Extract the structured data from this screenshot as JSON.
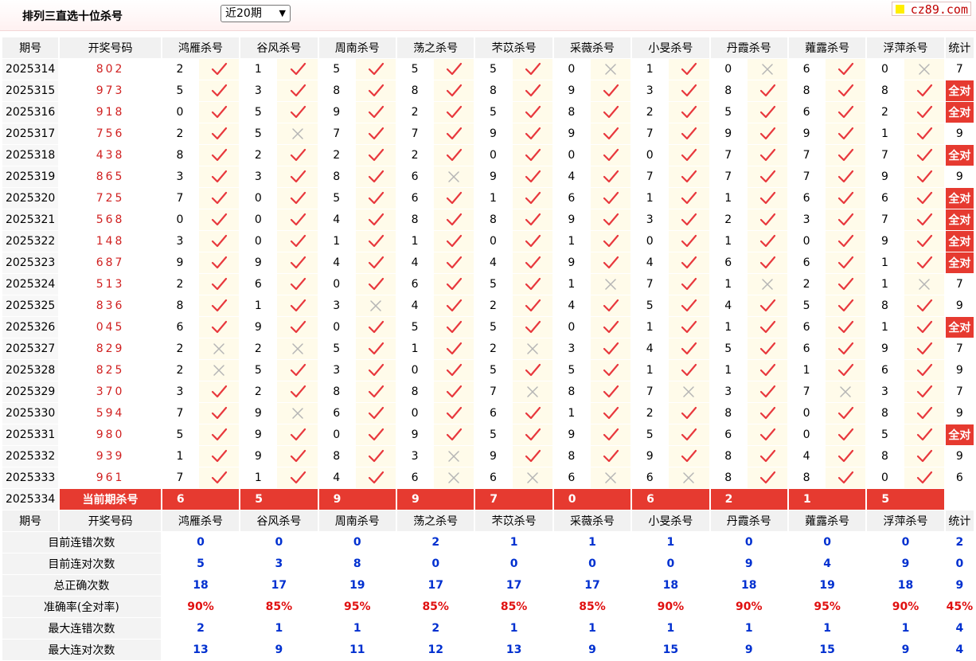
{
  "header": {
    "title": "排列三直选十位杀号",
    "period_select": "近20期",
    "logo": "cz89.com"
  },
  "columns": {
    "period": "期号",
    "draw": "开奖号码",
    "stat": "统计",
    "experts": [
      "鸿雁杀号",
      "谷风杀号",
      "周南杀号",
      "荡之杀号",
      "芣苡杀号",
      "采薇杀号",
      "小旻杀号",
      "丹霞杀号",
      "蕹露杀号",
      "浮萍杀号"
    ]
  },
  "rows": [
    {
      "period": "2025314",
      "draw": "802",
      "kills": [
        "2",
        "1",
        "5",
        "5",
        "5",
        "0",
        "1",
        "0",
        "6",
        "0"
      ],
      "hits": [
        1,
        1,
        1,
        1,
        1,
        0,
        1,
        0,
        1,
        0
      ],
      "stat": "7"
    },
    {
      "period": "2025315",
      "draw": "973",
      "kills": [
        "5",
        "3",
        "8",
        "8",
        "8",
        "9",
        "3",
        "8",
        "8",
        "8"
      ],
      "hits": [
        1,
        1,
        1,
        1,
        1,
        1,
        1,
        1,
        1,
        1
      ],
      "stat": "全对"
    },
    {
      "period": "2025316",
      "draw": "918",
      "kills": [
        "0",
        "5",
        "9",
        "2",
        "5",
        "8",
        "2",
        "5",
        "6",
        "2"
      ],
      "hits": [
        1,
        1,
        1,
        1,
        1,
        1,
        1,
        1,
        1,
        1
      ],
      "stat": "全对"
    },
    {
      "period": "2025317",
      "draw": "756",
      "kills": [
        "2",
        "5",
        "7",
        "7",
        "9",
        "9",
        "7",
        "9",
        "9",
        "1"
      ],
      "hits": [
        1,
        0,
        1,
        1,
        1,
        1,
        1,
        1,
        1,
        1
      ],
      "stat": "9"
    },
    {
      "period": "2025318",
      "draw": "438",
      "kills": [
        "8",
        "2",
        "2",
        "2",
        "0",
        "0",
        "0",
        "7",
        "7",
        "7"
      ],
      "hits": [
        1,
        1,
        1,
        1,
        1,
        1,
        1,
        1,
        1,
        1
      ],
      "stat": "全对"
    },
    {
      "period": "2025319",
      "draw": "865",
      "kills": [
        "3",
        "3",
        "8",
        "6",
        "9",
        "4",
        "7",
        "7",
        "7",
        "9"
      ],
      "hits": [
        1,
        1,
        1,
        0,
        1,
        1,
        1,
        1,
        1,
        1
      ],
      "stat": "9"
    },
    {
      "period": "2025320",
      "draw": "725",
      "kills": [
        "7",
        "0",
        "5",
        "6",
        "1",
        "6",
        "1",
        "1",
        "6",
        "6"
      ],
      "hits": [
        1,
        1,
        1,
        1,
        1,
        1,
        1,
        1,
        1,
        1
      ],
      "stat": "全对"
    },
    {
      "period": "2025321",
      "draw": "568",
      "kills": [
        "0",
        "0",
        "4",
        "8",
        "8",
        "9",
        "3",
        "2",
        "3",
        "7"
      ],
      "hits": [
        1,
        1,
        1,
        1,
        1,
        1,
        1,
        1,
        1,
        1
      ],
      "stat": "全对"
    },
    {
      "period": "2025322",
      "draw": "148",
      "kills": [
        "3",
        "0",
        "1",
        "1",
        "0",
        "1",
        "0",
        "1",
        "0",
        "9"
      ],
      "hits": [
        1,
        1,
        1,
        1,
        1,
        1,
        1,
        1,
        1,
        1
      ],
      "stat": "全对"
    },
    {
      "period": "2025323",
      "draw": "687",
      "kills": [
        "9",
        "9",
        "4",
        "4",
        "4",
        "9",
        "4",
        "6",
        "6",
        "1"
      ],
      "hits": [
        1,
        1,
        1,
        1,
        1,
        1,
        1,
        1,
        1,
        1
      ],
      "stat": "全对"
    },
    {
      "period": "2025324",
      "draw": "513",
      "kills": [
        "2",
        "6",
        "0",
        "6",
        "5",
        "1",
        "7",
        "1",
        "2",
        "1"
      ],
      "hits": [
        1,
        1,
        1,
        1,
        1,
        0,
        1,
        0,
        1,
        0
      ],
      "stat": "7"
    },
    {
      "period": "2025325",
      "draw": "836",
      "kills": [
        "8",
        "1",
        "3",
        "4",
        "2",
        "4",
        "5",
        "4",
        "5",
        "8"
      ],
      "hits": [
        1,
        1,
        0,
        1,
        1,
        1,
        1,
        1,
        1,
        1
      ],
      "stat": "9"
    },
    {
      "period": "2025326",
      "draw": "045",
      "kills": [
        "6",
        "9",
        "0",
        "5",
        "5",
        "0",
        "1",
        "1",
        "6",
        "1"
      ],
      "hits": [
        1,
        1,
        1,
        1,
        1,
        1,
        1,
        1,
        1,
        1
      ],
      "stat": "全对"
    },
    {
      "period": "2025327",
      "draw": "829",
      "kills": [
        "2",
        "2",
        "5",
        "1",
        "2",
        "3",
        "4",
        "5",
        "6",
        "9"
      ],
      "hits": [
        0,
        0,
        1,
        1,
        0,
        1,
        1,
        1,
        1,
        1
      ],
      "stat": "7"
    },
    {
      "period": "2025328",
      "draw": "825",
      "kills": [
        "2",
        "5",
        "3",
        "0",
        "5",
        "5",
        "1",
        "1",
        "1",
        "6"
      ],
      "hits": [
        0,
        1,
        1,
        1,
        1,
        1,
        1,
        1,
        1,
        1
      ],
      "stat": "9"
    },
    {
      "period": "2025329",
      "draw": "370",
      "kills": [
        "3",
        "2",
        "8",
        "8",
        "7",
        "8",
        "7",
        "3",
        "7",
        "3"
      ],
      "hits": [
        1,
        1,
        1,
        1,
        0,
        1,
        0,
        1,
        0,
        1
      ],
      "stat": "7"
    },
    {
      "period": "2025330",
      "draw": "594",
      "kills": [
        "7",
        "9",
        "6",
        "0",
        "6",
        "1",
        "2",
        "8",
        "0",
        "8"
      ],
      "hits": [
        1,
        0,
        1,
        1,
        1,
        1,
        1,
        1,
        1,
        1
      ],
      "stat": "9"
    },
    {
      "period": "2025331",
      "draw": "980",
      "kills": [
        "5",
        "9",
        "0",
        "9",
        "5",
        "9",
        "5",
        "6",
        "0",
        "5"
      ],
      "hits": [
        1,
        1,
        1,
        1,
        1,
        1,
        1,
        1,
        1,
        1
      ],
      "stat": "全对"
    },
    {
      "period": "2025332",
      "draw": "939",
      "kills": [
        "1",
        "9",
        "8",
        "3",
        "9",
        "8",
        "9",
        "8",
        "4",
        "8"
      ],
      "hits": [
        1,
        1,
        1,
        0,
        1,
        1,
        1,
        1,
        1,
        1
      ],
      "stat": "9"
    },
    {
      "period": "2025333",
      "draw": "961",
      "kills": [
        "7",
        "1",
        "4",
        "6",
        "6",
        "6",
        "6",
        "8",
        "8",
        "0"
      ],
      "hits": [
        1,
        1,
        1,
        0,
        0,
        0,
        0,
        1,
        1,
        1
      ],
      "stat": "6"
    }
  ],
  "current": {
    "period": "2025334",
    "label": "当前期杀号",
    "kills": [
      "6",
      "5",
      "9",
      "9",
      "7",
      "0",
      "6",
      "2",
      "1",
      "5"
    ]
  },
  "summary": [
    {
      "label": "目前连错次数",
      "values": [
        "0",
        "0",
        "0",
        "2",
        "1",
        "1",
        "1",
        "0",
        "0",
        "0"
      ],
      "stat": "2"
    },
    {
      "label": "目前连对次数",
      "values": [
        "5",
        "3",
        "8",
        "0",
        "0",
        "0",
        "0",
        "9",
        "4",
        "9"
      ],
      "stat": "0"
    },
    {
      "label": "总正确次数",
      "values": [
        "18",
        "17",
        "19",
        "17",
        "17",
        "17",
        "18",
        "18",
        "19",
        "18"
      ],
      "stat": "9"
    },
    {
      "label": "准确率(全对率)",
      "values": [
        "90%",
        "85%",
        "95%",
        "85%",
        "85%",
        "85%",
        "90%",
        "90%",
        "95%",
        "90%"
      ],
      "stat": "45%"
    },
    {
      "label": "最大连错次数",
      "values": [
        "2",
        "1",
        "1",
        "2",
        "1",
        "1",
        "1",
        "1",
        "1",
        "1"
      ],
      "stat": "4"
    },
    {
      "label": "最大连对次数",
      "values": [
        "13",
        "9",
        "11",
        "12",
        "13",
        "9",
        "15",
        "9",
        "15",
        "9"
      ],
      "stat": "4"
    }
  ],
  "colors": {
    "accent_red": "#e63a30",
    "check": "#e8383d",
    "cross": "#b5b5b5",
    "summary_blue": "#0030d0"
  },
  "icons": {
    "hit": "check-icon",
    "miss": "cross-icon",
    "dropdown": "chevron-down-icon"
  }
}
